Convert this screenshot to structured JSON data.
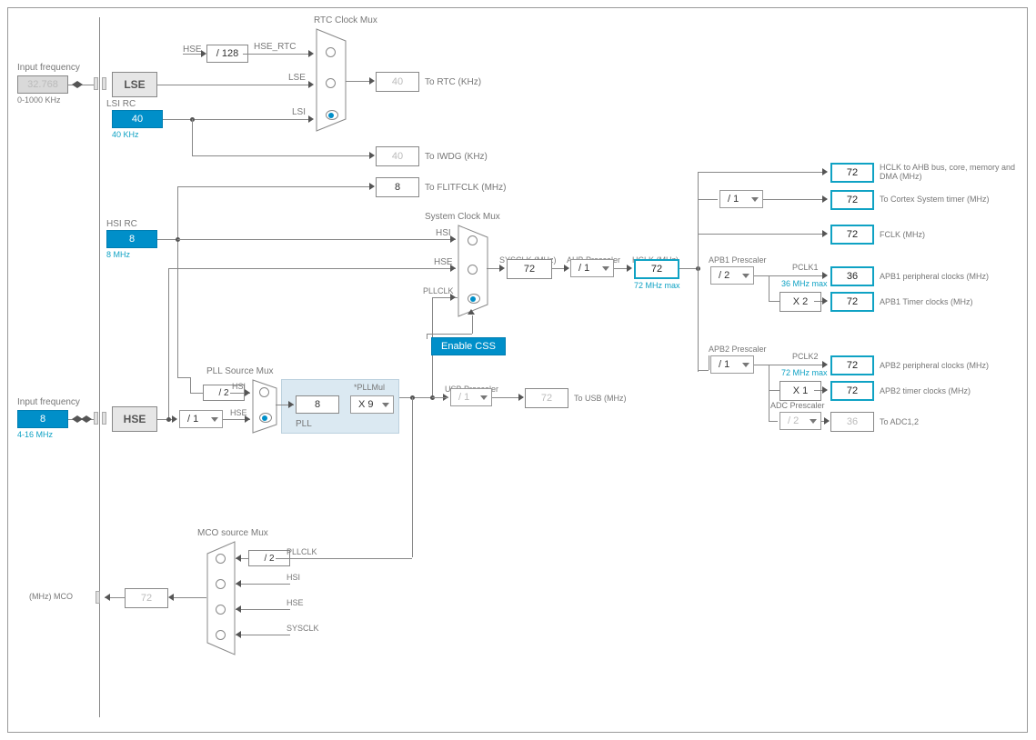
{
  "lse": {
    "input_freq_label": "Input frequency",
    "value": "32.768",
    "range": "0-1000 KHz",
    "name": "LSE"
  },
  "lsi": {
    "label": "LSI RC",
    "value": "40",
    "freq": "40 KHz"
  },
  "hse_div": {
    "value": "/ 128",
    "hse_label": "HSE",
    "hse_rtc_label": "HSE_RTC"
  },
  "rtc_mux": {
    "title": "RTC Clock Mux",
    "lse": "LSE",
    "lsi": "LSI",
    "out": "40",
    "out_label": "To RTC (KHz)"
  },
  "iwdg": {
    "out": "40",
    "label": "To IWDG (KHz)"
  },
  "hsi": {
    "label": "HSI RC",
    "value": "8",
    "freq": "8 MHz"
  },
  "flitf": {
    "value": "8",
    "label": "To FLITFCLK (MHz)"
  },
  "hse": {
    "input_freq_label": "Input frequency",
    "value": "8",
    "range": "4-16 MHz",
    "name": "HSE"
  },
  "hse_presc": {
    "value": "/ 1"
  },
  "pll_src_mux": {
    "title": "PLL Source Mux",
    "hsi_div": "/ 2",
    "hsi": "HSI",
    "hse": "HSE"
  },
  "pll": {
    "name": "PLL",
    "in": "8",
    "mul_label": "*PLLMul",
    "mul": "X 9"
  },
  "usb": {
    "presc_label": "USB Prescaler",
    "presc": "/ 1",
    "out": "72",
    "label": "To USB (MHz)"
  },
  "sysmux": {
    "title": "System Clock Mux",
    "hsi": "HSI",
    "hse": "HSE",
    "pll": "PLLCLK",
    "css": "Enable CSS"
  },
  "sysclk": {
    "label": "SYSCLK (MHz)",
    "value": "72"
  },
  "ahb": {
    "label": "AHB Prescaler",
    "value": "/ 1"
  },
  "hclk": {
    "label": "HCLK (MHz)",
    "value": "72",
    "max": "72 MHz max"
  },
  "outputs": {
    "ahb": {
      "value": "72",
      "label": "HCLK to AHB bus, core, memory and DMA (MHz)"
    },
    "cortex": {
      "presc": "/ 1",
      "value": "72",
      "label": "To Cortex System timer (MHz)"
    },
    "fclk": {
      "value": "72",
      "label": "FCLK (MHz)"
    },
    "apb1_presc_label": "APB1 Prescaler",
    "apb1": {
      "presc": "/ 2",
      "pclk1_label": "PCLK1",
      "max": "36 MHz max",
      "value": "36",
      "label": "APB1 peripheral clocks (MHz)"
    },
    "apb1_timer": {
      "mul": "X 2",
      "value": "72",
      "label": "APB1 Timer clocks (MHz)"
    },
    "apb2_presc_label": "APB2 Prescaler",
    "apb2": {
      "presc": "/ 1",
      "pclk2_label": "PCLK2",
      "max": "72 MHz max",
      "value": "72",
      "label": "APB2 peripheral clocks (MHz)"
    },
    "apb2_timer": {
      "mul": "X 1",
      "value": "72",
      "label": "APB2 timer clocks (MHz)"
    },
    "adc": {
      "presc_label": "ADC Prescaler",
      "presc": "/ 2",
      "value": "36",
      "label": "To ADC1,2"
    }
  },
  "mco": {
    "title": "MCO source Mux",
    "div": "/ 2",
    "pllclk": "PLLCLK",
    "hsi": "HSI",
    "hse": "HSE",
    "sysclk": "SYSCLK",
    "out": "72",
    "label": "(MHz) MCO"
  }
}
